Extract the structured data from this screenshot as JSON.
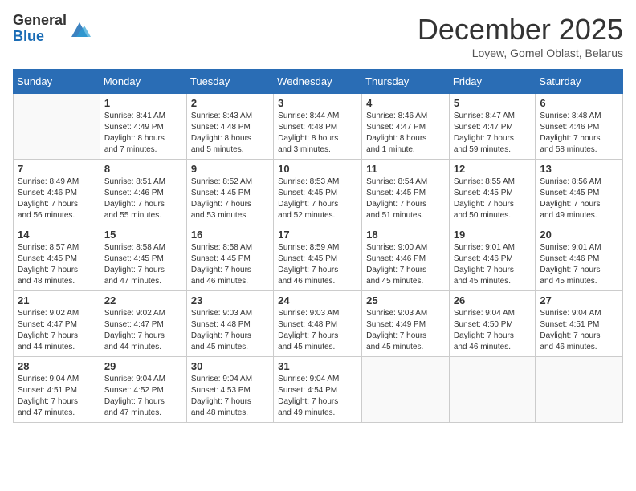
{
  "logo": {
    "general": "General",
    "blue": "Blue"
  },
  "header": {
    "month": "December 2025",
    "location": "Loyew, Gomel Oblast, Belarus"
  },
  "weekdays": [
    "Sunday",
    "Monday",
    "Tuesday",
    "Wednesday",
    "Thursday",
    "Friday",
    "Saturday"
  ],
  "weeks": [
    [
      {
        "day": "",
        "info": ""
      },
      {
        "day": "1",
        "info": "Sunrise: 8:41 AM\nSunset: 4:49 PM\nDaylight: 8 hours\nand 7 minutes."
      },
      {
        "day": "2",
        "info": "Sunrise: 8:43 AM\nSunset: 4:48 PM\nDaylight: 8 hours\nand 5 minutes."
      },
      {
        "day": "3",
        "info": "Sunrise: 8:44 AM\nSunset: 4:48 PM\nDaylight: 8 hours\nand 3 minutes."
      },
      {
        "day": "4",
        "info": "Sunrise: 8:46 AM\nSunset: 4:47 PM\nDaylight: 8 hours\nand 1 minute."
      },
      {
        "day": "5",
        "info": "Sunrise: 8:47 AM\nSunset: 4:47 PM\nDaylight: 7 hours\nand 59 minutes."
      },
      {
        "day": "6",
        "info": "Sunrise: 8:48 AM\nSunset: 4:46 PM\nDaylight: 7 hours\nand 58 minutes."
      }
    ],
    [
      {
        "day": "7",
        "info": "Sunrise: 8:49 AM\nSunset: 4:46 PM\nDaylight: 7 hours\nand 56 minutes."
      },
      {
        "day": "8",
        "info": "Sunrise: 8:51 AM\nSunset: 4:46 PM\nDaylight: 7 hours\nand 55 minutes."
      },
      {
        "day": "9",
        "info": "Sunrise: 8:52 AM\nSunset: 4:45 PM\nDaylight: 7 hours\nand 53 minutes."
      },
      {
        "day": "10",
        "info": "Sunrise: 8:53 AM\nSunset: 4:45 PM\nDaylight: 7 hours\nand 52 minutes."
      },
      {
        "day": "11",
        "info": "Sunrise: 8:54 AM\nSunset: 4:45 PM\nDaylight: 7 hours\nand 51 minutes."
      },
      {
        "day": "12",
        "info": "Sunrise: 8:55 AM\nSunset: 4:45 PM\nDaylight: 7 hours\nand 50 minutes."
      },
      {
        "day": "13",
        "info": "Sunrise: 8:56 AM\nSunset: 4:45 PM\nDaylight: 7 hours\nand 49 minutes."
      }
    ],
    [
      {
        "day": "14",
        "info": "Sunrise: 8:57 AM\nSunset: 4:45 PM\nDaylight: 7 hours\nand 48 minutes."
      },
      {
        "day": "15",
        "info": "Sunrise: 8:58 AM\nSunset: 4:45 PM\nDaylight: 7 hours\nand 47 minutes."
      },
      {
        "day": "16",
        "info": "Sunrise: 8:58 AM\nSunset: 4:45 PM\nDaylight: 7 hours\nand 46 minutes."
      },
      {
        "day": "17",
        "info": "Sunrise: 8:59 AM\nSunset: 4:45 PM\nDaylight: 7 hours\nand 46 minutes."
      },
      {
        "day": "18",
        "info": "Sunrise: 9:00 AM\nSunset: 4:46 PM\nDaylight: 7 hours\nand 45 minutes."
      },
      {
        "day": "19",
        "info": "Sunrise: 9:01 AM\nSunset: 4:46 PM\nDaylight: 7 hours\nand 45 minutes."
      },
      {
        "day": "20",
        "info": "Sunrise: 9:01 AM\nSunset: 4:46 PM\nDaylight: 7 hours\nand 45 minutes."
      }
    ],
    [
      {
        "day": "21",
        "info": "Sunrise: 9:02 AM\nSunset: 4:47 PM\nDaylight: 7 hours\nand 44 minutes."
      },
      {
        "day": "22",
        "info": "Sunrise: 9:02 AM\nSunset: 4:47 PM\nDaylight: 7 hours\nand 44 minutes."
      },
      {
        "day": "23",
        "info": "Sunrise: 9:03 AM\nSunset: 4:48 PM\nDaylight: 7 hours\nand 45 minutes."
      },
      {
        "day": "24",
        "info": "Sunrise: 9:03 AM\nSunset: 4:48 PM\nDaylight: 7 hours\nand 45 minutes."
      },
      {
        "day": "25",
        "info": "Sunrise: 9:03 AM\nSunset: 4:49 PM\nDaylight: 7 hours\nand 45 minutes."
      },
      {
        "day": "26",
        "info": "Sunrise: 9:04 AM\nSunset: 4:50 PM\nDaylight: 7 hours\nand 46 minutes."
      },
      {
        "day": "27",
        "info": "Sunrise: 9:04 AM\nSunset: 4:51 PM\nDaylight: 7 hours\nand 46 minutes."
      }
    ],
    [
      {
        "day": "28",
        "info": "Sunrise: 9:04 AM\nSunset: 4:51 PM\nDaylight: 7 hours\nand 47 minutes."
      },
      {
        "day": "29",
        "info": "Sunrise: 9:04 AM\nSunset: 4:52 PM\nDaylight: 7 hours\nand 47 minutes."
      },
      {
        "day": "30",
        "info": "Sunrise: 9:04 AM\nSunset: 4:53 PM\nDaylight: 7 hours\nand 48 minutes."
      },
      {
        "day": "31",
        "info": "Sunrise: 9:04 AM\nSunset: 4:54 PM\nDaylight: 7 hours\nand 49 minutes."
      },
      {
        "day": "",
        "info": ""
      },
      {
        "day": "",
        "info": ""
      },
      {
        "day": "",
        "info": ""
      }
    ]
  ]
}
